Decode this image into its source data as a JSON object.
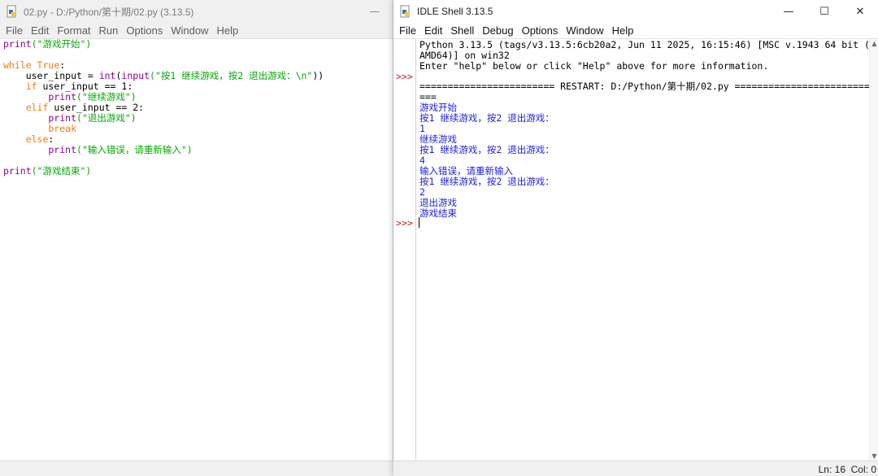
{
  "editor": {
    "title": "02.py - D:/Python/第十期/02.py (3.13.5)",
    "minimize": "—",
    "menu": [
      "File",
      "Edit",
      "Format",
      "Run",
      "Options",
      "Window",
      "Help"
    ],
    "code": {
      "l1_print": "print",
      "l1_str": "(\"游戏开始\")",
      "l3_while": "while",
      "l3_true": " True",
      "l3_colon": ":",
      "l4_a": "    user_input = ",
      "l4_int": "int",
      "l4_b": "(",
      "l4_input": "input",
      "l4_str": "(\"按1 继续游戏，按2 退出游戏：\\n\"",
      "l4_c": "))",
      "l5_if": "    if",
      "l5_rest": " user_input == 1:",
      "l6_print": "        print",
      "l6_str": "(\"继续游戏\")",
      "l7_elif": "    elif",
      "l7_rest": " user_input == 2:",
      "l8_print": "        print",
      "l8_str": "(\"退出游戏\")",
      "l9_break": "        break",
      "l10_else": "    else",
      "l10_colon": ":",
      "l11_print": "        print",
      "l11_str": "(\"输入错误，请重新输入\")",
      "l13_print": "print",
      "l13_str": "(\"游戏结束\")"
    }
  },
  "shell": {
    "title": "IDLE Shell 3.13.5",
    "controls": {
      "minimize": "—",
      "maximize": "☐",
      "close": "✕"
    },
    "menu": [
      "File",
      "Edit",
      "Shell",
      "Debug",
      "Options",
      "Window",
      "Help"
    ],
    "banner_line1": "Python 3.13.5 (tags/v3.13.5:6cb20a2, Jun 11 2025, 16:15:46) [MSC v.1943 64 bit (",
    "banner_line2": "AMD64)] on win32",
    "banner_line3": "Enter \"help\" below or click \"Help\" above for more information.",
    "restart_line1": "======================== RESTART: D:/Python/第十期/02.py ========================",
    "restart_line2": "===",
    "output": [
      "游戏开始",
      "按1 继续游戏，按2 退出游戏：",
      "1",
      "继续游戏",
      "按1 继续游戏，按2 退出游戏：",
      "4",
      "输入错误，请重新输入",
      "按1 继续游戏，按2 退出游戏：",
      "2",
      "退出游戏",
      "游戏结束"
    ],
    "prompt": ">>>",
    "status": {
      "ln": "Ln: 16",
      "col": "Col: 0"
    }
  }
}
